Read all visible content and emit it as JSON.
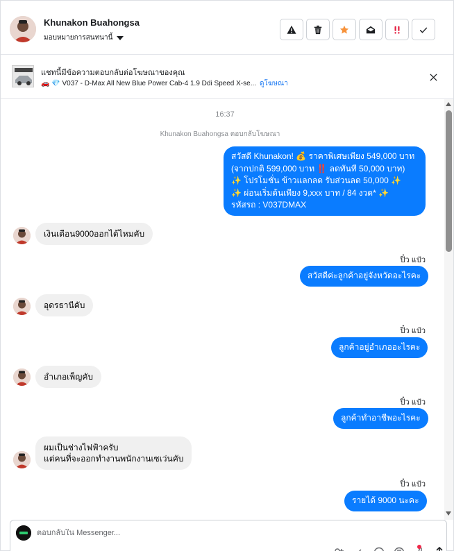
{
  "header": {
    "contact_name": "Khunakon Buahongsa",
    "assign_label": "มอบหมายการสนทนานี้",
    "actions": [
      {
        "icon": "spam-warning-icon"
      },
      {
        "icon": "trash-icon"
      },
      {
        "icon": "star-icon",
        "color": "#f7923a"
      },
      {
        "icon": "mark-unread-icon"
      },
      {
        "icon": "follow-up-icon",
        "color": "#e41e3f"
      },
      {
        "icon": "checkmark-done-icon"
      }
    ]
  },
  "ad_banner": {
    "title": "แชทนี้มีข้อความตอบกลับต่อโฆษณาของคุณ",
    "subtitle": "🚗 💎 V037 - D-Max All New Blue Power Cab-4 1.9 Ddi Speed X-se...",
    "link": "ดูโฆษณา"
  },
  "chat": {
    "timestamp": "16:37",
    "reply_note": "Khunakon Buahongsa ตอบกลับโฆษณา",
    "ad_message_lines": [
      "สวัสดี Khunakon! 💰 ราคาพิเศษเพียง 549,000 บาท",
      "(จากปกติ 599,000 บาท ‼️ ลดทันที 50,000 บาท)",
      "✨ โปรโมชั่น ข้าวแลกลด รับส่วนลด 50,000 ✨",
      "✨ ผ่อนเริ่มต้นเพียง 9,xxx บาท / 84 งวด* ✨",
      "รหัสรถ : V037DMAX"
    ],
    "messages": [
      {
        "from": "customer",
        "text": "เงินเดือน9000ออกได้ไหมคับ"
      },
      {
        "from": "page",
        "sender": "ปิ๋ว แป๋ว",
        "text": "สวัสดีค่ะลูกค้าอยู่จังหวัดอะไรคะ"
      },
      {
        "from": "customer",
        "text": "อุดรธานีคับ"
      },
      {
        "from": "page",
        "sender": "ปิ๋ว แป๋ว",
        "text": "ลูกค้าอยู่อำเภออะไรคะ"
      },
      {
        "from": "customer",
        "text": "อำเภอเพ็ญคับ"
      },
      {
        "from": "page",
        "sender": "ปิ๋ว แป๋ว",
        "text": "ลูกค้าทำอาชีพอะไรคะ"
      },
      {
        "from": "customer",
        "text": "ผมเป็นช่างไฟฟ้าครับ",
        "text2": "แต่คนที่จะออกทำงานพนักงานเซเว่นคับ"
      },
      {
        "from": "page",
        "sender": "ปิ๋ว แป๋ว",
        "text": "รายได้ 9000  นะคะ"
      }
    ]
  },
  "composer": {
    "placeholder": "ตอบกลับใน Messenger..."
  },
  "colors": {
    "outgoing_bubble": "#0a7cff",
    "incoming_bubble": "#f0f0f0",
    "link": "#1877f2"
  }
}
